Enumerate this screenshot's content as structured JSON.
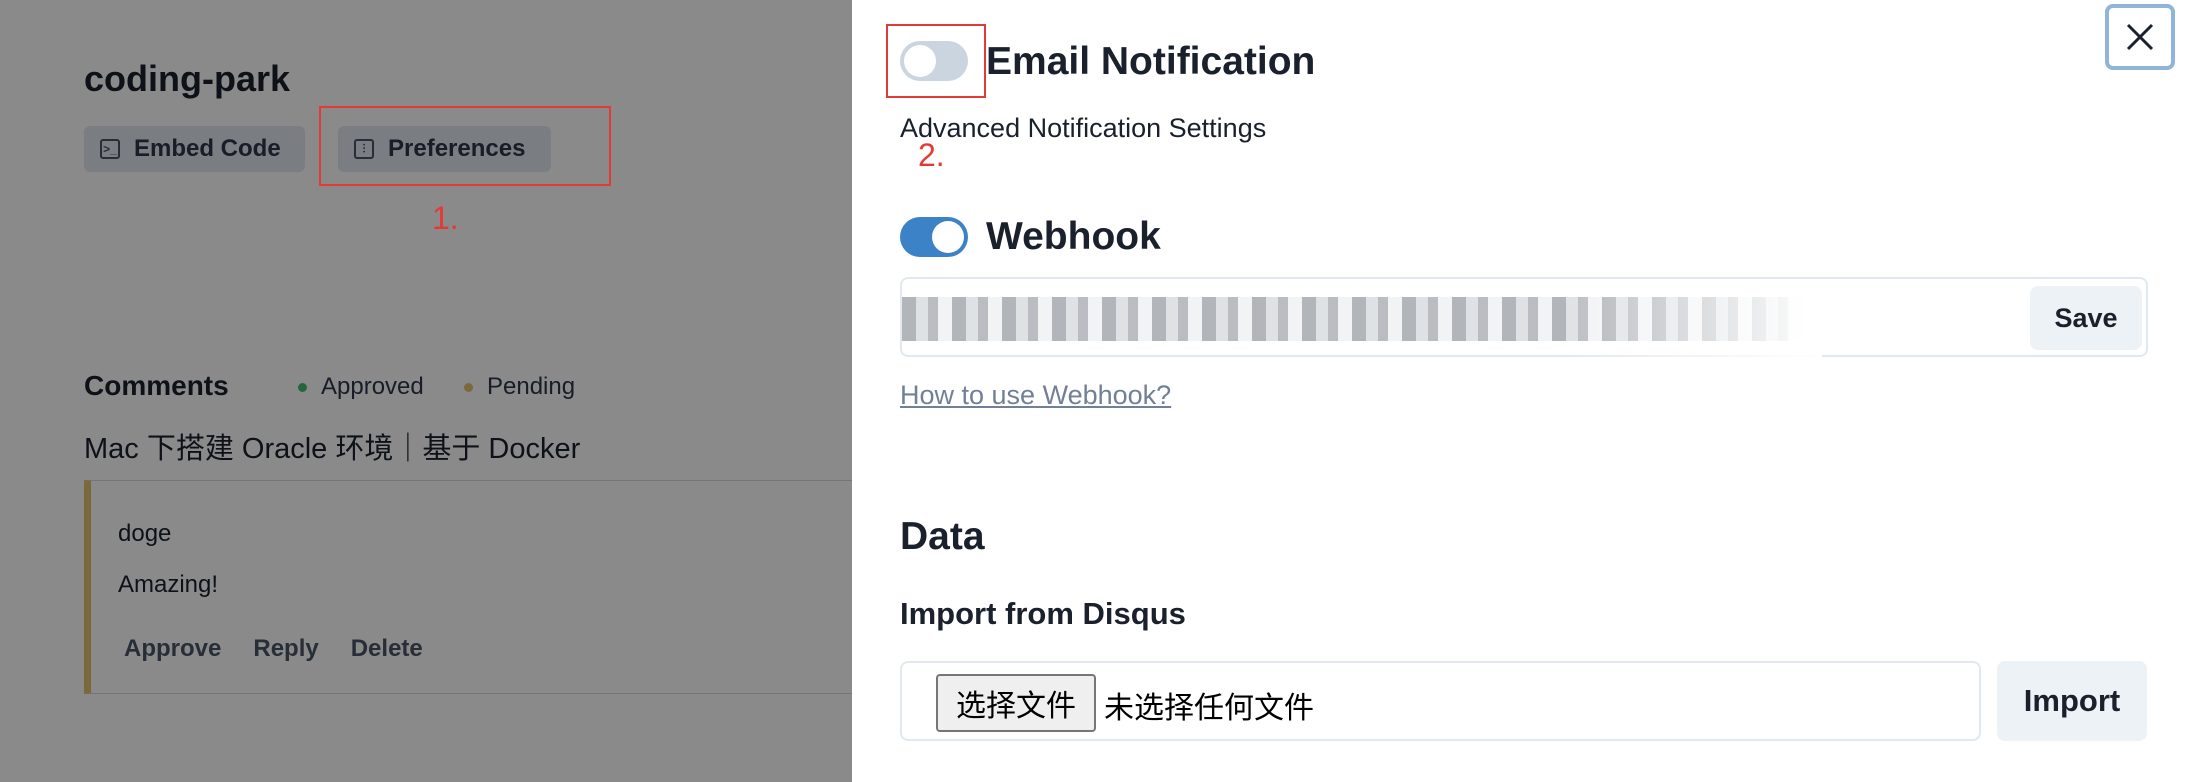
{
  "site": {
    "title": "coding-park"
  },
  "toolbar": {
    "embed_label": "Embed Code",
    "preferences_label": "Preferences"
  },
  "comments": {
    "heading": "Comments",
    "legend": {
      "approved": "Approved",
      "pending": "Pending",
      "approved_color": "#48bb78",
      "pending_color": "#e6c26a"
    },
    "post_title": "Mac 下搭建 Oracle 环境｜基于 Docker",
    "items": [
      {
        "author": "doge",
        "body": "Amazing!",
        "actions": {
          "approve": "Approve",
          "reply": "Reply",
          "delete": "Delete"
        }
      }
    ]
  },
  "annotations": {
    "step1": "1.",
    "step2": "2."
  },
  "drawer": {
    "email": {
      "title": "Email Notification",
      "enabled": false,
      "subtitle": "Advanced Notification Settings"
    },
    "webhook": {
      "title": "Webhook",
      "enabled": true,
      "value": "",
      "save_label": "Save",
      "help_link": "How to use Webhook?"
    },
    "data": {
      "heading": "Data",
      "import_heading": "Import from Disqus",
      "file_button": "选择文件",
      "file_status": "未选择任何文件",
      "import_label": "Import"
    },
    "close_icon": "close-icon"
  },
  "colors": {
    "accent": "#3b82c6",
    "annotation": "#e53935",
    "toggle_off": "#cbd5e0"
  }
}
